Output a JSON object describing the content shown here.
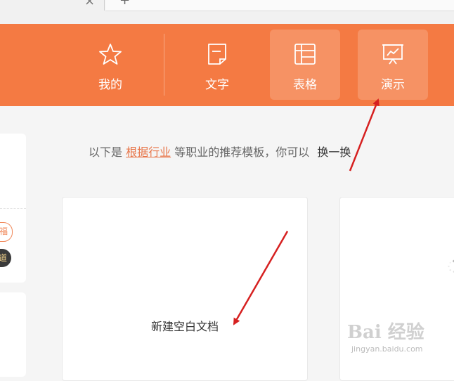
{
  "tabstrip": {
    "close_glyph": "×",
    "new_glyph": "+"
  },
  "nav": {
    "items": [
      {
        "label": "我的",
        "icon": "star-icon"
      },
      {
        "label": "文字",
        "icon": "document-icon"
      },
      {
        "label": "表格",
        "icon": "table-icon"
      },
      {
        "label": "演示",
        "icon": "presentation-icon"
      }
    ]
  },
  "recommend": {
    "prefix": "以下是",
    "link": "根据行业",
    "middle": "等职业的推荐模板，你可以",
    "swap": "换一换"
  },
  "cards": {
    "blank_label": "新建空白文档"
  },
  "left_badges": {
    "outline_text": "福",
    "dark_text": "道"
  },
  "watermark": {
    "main": "Bai 经验",
    "sub": "jingyan.baidu.com"
  },
  "colors": {
    "header": "#f47a43",
    "link": "#e8764a",
    "arrow": "#d62020"
  }
}
